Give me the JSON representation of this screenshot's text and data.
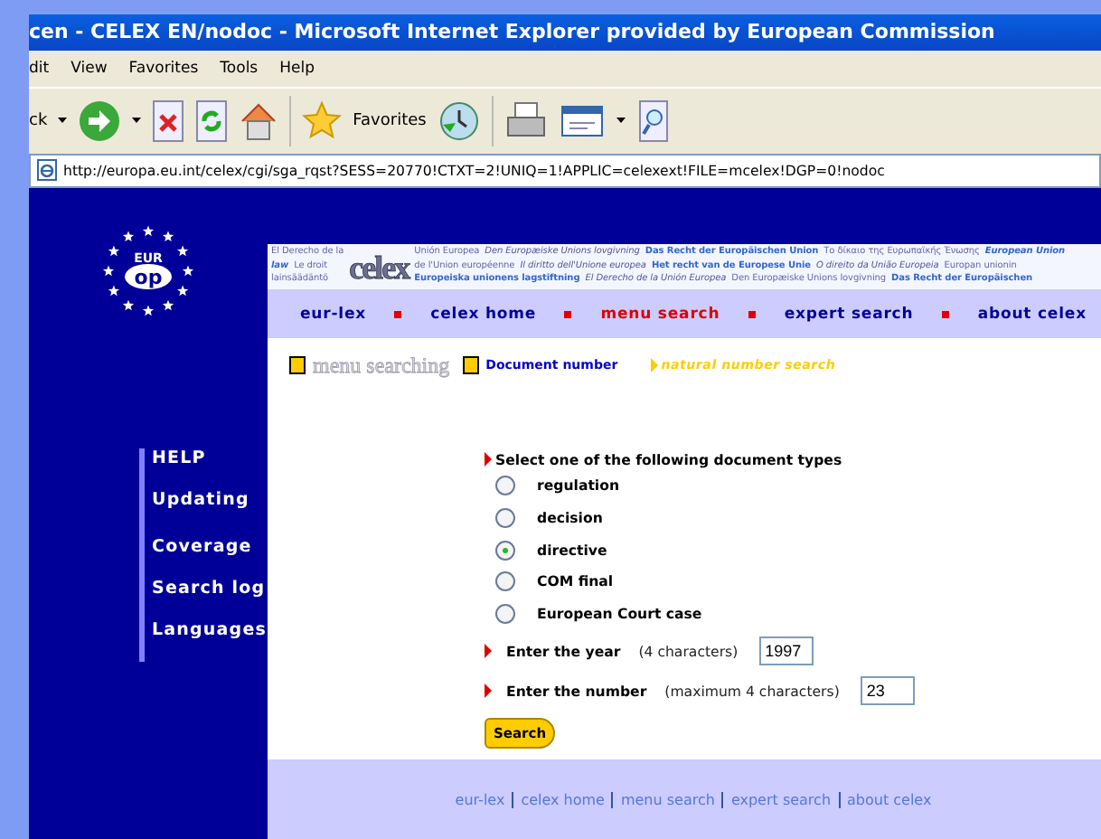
{
  "window": {
    "title": "cen - CELEX EN/nodoc - Microsoft Internet Explorer provided by European Commission"
  },
  "menu_bar": [
    "dit",
    "View",
    "Favorites",
    "Tools",
    "Help"
  ],
  "toolbar": {
    "back_label": "ck",
    "favorites_label": "Favorites"
  },
  "address_bar": {
    "url": "http://europa.eu.int/celex/cgi/sga_rqst?SESS=20770!CTXT=2!UNIQ=1!APPLIC=celexext!FILE=mcelex!DGP=0!nodoc"
  },
  "logo": {
    "top": "EUR",
    "badge": "op"
  },
  "sidebar": {
    "items": [
      "HELP",
      "Updating",
      "Coverage",
      "Search log",
      "Languages"
    ]
  },
  "banner": {
    "logo": "celex",
    "lines": [
      {
        "before": [
          {
            "text": "El Derecho de la",
            "kind": "plain"
          }
        ],
        "after": [
          {
            "text": "Unión Europea",
            "kind": "plain"
          },
          {
            "text": "Den Europæiske Unions lovgivning",
            "kind": "italic"
          },
          {
            "text": "Das Recht der Europäischen Union",
            "kind": "bold"
          },
          {
            "text": "Το δίκαιο της Ευρωπαϊκής Ένωσης",
            "kind": "plain"
          },
          {
            "text": "European Union",
            "kind": "bolditalic"
          }
        ]
      },
      {
        "before": [
          {
            "text": "law",
            "kind": "bolditalic"
          },
          {
            "text": "Le droit",
            "kind": "plain"
          }
        ],
        "after": [
          {
            "text": "de l'Union européenne",
            "kind": "plain"
          },
          {
            "text": "Il diritto dell'Unione europea",
            "kind": "italic"
          },
          {
            "text": "Het recht van de Europese Unie",
            "kind": "bold"
          },
          {
            "text": "O direito da União Europeia",
            "kind": "italic"
          },
          {
            "text": "Europan unionin",
            "kind": "plain"
          }
        ]
      },
      {
        "before": [
          {
            "text": "lainsäädäntö",
            "kind": "plain"
          }
        ],
        "after": [
          {
            "text": "Europeiska unionens lagstiftning",
            "kind": "bold"
          },
          {
            "text": "El Derecho de la Unión Europea",
            "kind": "italic"
          },
          {
            "text": "Den Europæiske Unions lovgivning",
            "kind": "plain"
          },
          {
            "text": "Das Recht der Europäischen",
            "kind": "bold"
          }
        ]
      }
    ]
  },
  "nav": [
    {
      "label": "eur-lex",
      "selected": false
    },
    {
      "label": "celex home",
      "selected": false
    },
    {
      "label": "menu search",
      "selected": true
    },
    {
      "label": "expert search",
      "selected": false
    },
    {
      "label": "about celex",
      "selected": false
    }
  ],
  "breadcrumb": {
    "section": "menu searching",
    "page": "Document number",
    "current": "natural number search"
  },
  "form": {
    "prompt": "Select one of the following document types",
    "types": [
      {
        "label": "regulation",
        "selected": false
      },
      {
        "label": "decision",
        "selected": false
      },
      {
        "label": "directive",
        "selected": true
      },
      {
        "label": "COM final",
        "selected": false
      },
      {
        "label": "European Court case",
        "selected": false
      }
    ],
    "year": {
      "label": "Enter the year",
      "hint": "(4 characters)",
      "value": "1997"
    },
    "number": {
      "label": "Enter the number",
      "hint": "(maximum 4 characters)",
      "value": "23"
    },
    "button": "Search"
  },
  "footer": [
    "eur-lex",
    "celex home",
    "menu search",
    "expert search",
    "about celex"
  ]
}
